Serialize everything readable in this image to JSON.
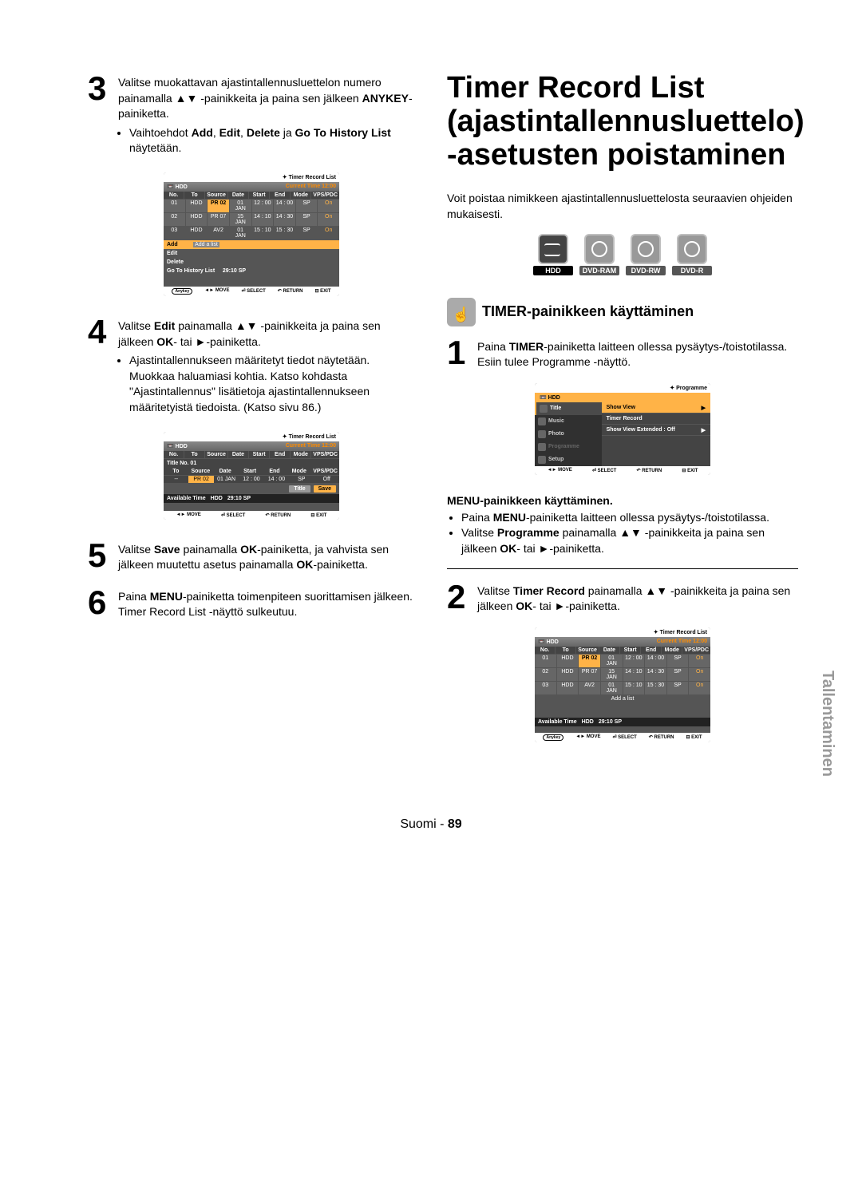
{
  "left": {
    "step3": {
      "num": "3",
      "line1_a": "Valitse muokattavan ajastintallennusluettelon numero painamalla ",
      "line1_b": " -painikkeita ja paina sen jälkeen ",
      "line1_c": "-painiketta.",
      "anykey": "ANYKEY",
      "bullet_a": "Vaihtoehdot ",
      "bullet_b": " ja ",
      "bullet_c": " näytetään.",
      "opt_add": "Add",
      "opt_edit": "Edit",
      "opt_delete": "Delete",
      "opt_history": "Go To History List"
    },
    "ui1": {
      "title": "Timer Record List",
      "hdd": "HDD",
      "current": "Current Time 12:00",
      "headers": [
        "No.",
        "To",
        "Source",
        "Date",
        "Start",
        "End",
        "Mode",
        "VPS/PDC"
      ],
      "rows": [
        [
          "01",
          "HDD",
          "PR 02",
          "01 JAN",
          "12 : 00",
          "14 : 00",
          "SP",
          "On"
        ],
        [
          "02",
          "HDD",
          "PR 07",
          "15 JAN",
          "14 : 10",
          "14 : 30",
          "SP",
          "On"
        ],
        [
          "03",
          "HDD",
          "AV2",
          "01 JAN",
          "15 : 10",
          "15 : 30",
          "SP",
          "On"
        ]
      ],
      "menu_add": "Add",
      "menu_add_note": "Add a list",
      "menu_edit": "Edit",
      "menu_delete": "Delete",
      "menu_history": "Go To History List",
      "menu_avail": "29:10  SP",
      "footer_pill": "Anykey",
      "footer": [
        "MOVE",
        "SELECT",
        "RETURN",
        "EXIT"
      ]
    },
    "step4": {
      "num": "4",
      "line1_a": "Valitse ",
      "line1_b": " painamalla ",
      "line1_c": " -painikkeita ja paina sen jälkeen ",
      "line1_d": "- tai ",
      "line1_e": "-painiketta.",
      "edit": "Edit",
      "ok": "OK",
      "bullet": "Ajastintallennukseen määritetyt tiedot näytetään. Muokkaa haluamiasi kohtia. Katso kohdasta \"Ajastintallennus\" lisätietoja ajastintallennukseen määritetyistä tiedoista. (Katso sivu 86.)"
    },
    "ui2": {
      "title": "Timer Record List",
      "hdd": "HDD",
      "current": "Current Time 12:00",
      "main_headers": [
        "No.",
        "To",
        "Source",
        "Date",
        "Start",
        "End",
        "Mode",
        "VPS/PDC"
      ],
      "title_no": "Title No. 01",
      "inner_headers": [
        "To",
        "Source",
        "Date",
        "Start",
        "End",
        "Mode",
        "VPS/PDC"
      ],
      "inner_row": [
        "--",
        "PR 02",
        "01 JAN",
        "12 : 00",
        "14 : 00",
        "SP",
        "Off"
      ],
      "btn_title": "Title",
      "btn_save": "Save",
      "avail_label": "Available Time",
      "avail_hdd": "HDD",
      "avail_time": "29:10  SP",
      "footer": [
        "MOVE",
        "SELECT",
        "RETURN",
        "EXIT"
      ]
    },
    "step5": {
      "num": "5",
      "line_a": "Valitse ",
      "line_b": " painamalla ",
      "line_c": "-painiketta, ja vahvista sen jälkeen muutettu asetus painamalla ",
      "line_d": "-painiketta.",
      "save": "Save",
      "ok": "OK"
    },
    "step6": {
      "num": "6",
      "line_a": "Paina ",
      "line_b": "-painiketta toimenpiteen suorittamisen jälkeen. Timer Record List -näyttö sulkeutuu.",
      "menu": "MENU"
    }
  },
  "right": {
    "title": "Timer Record List (ajastintallennusluettelo) -asetusten poistaminen",
    "intro": "Voit poistaa nimikkeen ajastintallennusluettelosta seuraavien ohjeiden mukaisesti.",
    "badges": [
      "HDD",
      "DVD-RAM",
      "DVD-RW",
      "DVD-R"
    ],
    "heading": "TIMER-painikkeen käyttäminen",
    "step1": {
      "num": "1",
      "line_a": "Paina ",
      "line_b": "-painiketta laitteen ollessa pysäytys-/toistotilassa.",
      "line_c": "Esiin tulee Programme -näyttö.",
      "timer": "TIMER"
    },
    "prog": {
      "title": "Programme",
      "hdd": "HDD",
      "left_items": [
        "Title",
        "Music",
        "Photo",
        "Programme",
        "Setup"
      ],
      "right_items": [
        {
          "label": "Show View",
          "arrow": "▶",
          "sel": true
        },
        {
          "label": "Timer Record",
          "arrow": "",
          "sel": false
        },
        {
          "label": "Show View Extended  : Off",
          "arrow": "▶",
          "sel": false
        }
      ],
      "footer": [
        "MOVE",
        "SELECT",
        "RETURN",
        "EXIT"
      ]
    },
    "sub_heading": "MENU-painikkeen käyttäminen.",
    "menu_b1_a": "Paina ",
    "menu_b1_b": "-painiketta laitteen ollessa pysäytys-/toistotilassa.",
    "menu_b1_menu": "MENU",
    "menu_b2_a": "Valitse ",
    "menu_b2_b": " painamalla ",
    "menu_b2_c": " -painikkeita ja paina sen jälkeen ",
    "menu_b2_d": "- tai ",
    "menu_b2_e": "-painiketta.",
    "menu_b2_prog": "Programme",
    "menu_b2_ok": "OK",
    "step2": {
      "num": "2",
      "line_a": "Valitse ",
      "line_b": " painamalla ",
      "line_c": " -painikkeita ja paina sen jälkeen ",
      "line_d": "- tai ",
      "line_e": "-painiketta.",
      "tr": "Timer Record",
      "ok": "OK"
    },
    "ui3": {
      "title": "Timer Record List",
      "hdd": "HDD",
      "current": "Current Time 12:00",
      "headers": [
        "No.",
        "To",
        "Source",
        "Date",
        "Start",
        "End",
        "Mode",
        "VPS/PDC"
      ],
      "rows": [
        [
          "01",
          "HDD",
          "PR 02",
          "01 JAN",
          "12 : 00",
          "14 : 00",
          "SP",
          "On"
        ],
        [
          "02",
          "HDD",
          "PR 07",
          "15 JAN",
          "14 : 10",
          "14 : 30",
          "SP",
          "On"
        ],
        [
          "03",
          "HDD",
          "AV2",
          "01 JAN",
          "15 : 10",
          "15 : 30",
          "SP",
          "On"
        ]
      ],
      "add_list": "Add a list",
      "avail_label": "Available Time",
      "avail_hdd": "HDD",
      "avail_time": "29:10  SP",
      "footer_pill": "Anykey",
      "footer": [
        "MOVE",
        "SELECT",
        "RETURN",
        "EXIT"
      ]
    }
  },
  "chrome": {
    "side_tab": "Tallentaminen",
    "footer_a": "Suomi - ",
    "footer_b": "89"
  },
  "glyphs": {
    "updown": "▲▼",
    "play": "►",
    "move_pre": "◄►"
  }
}
